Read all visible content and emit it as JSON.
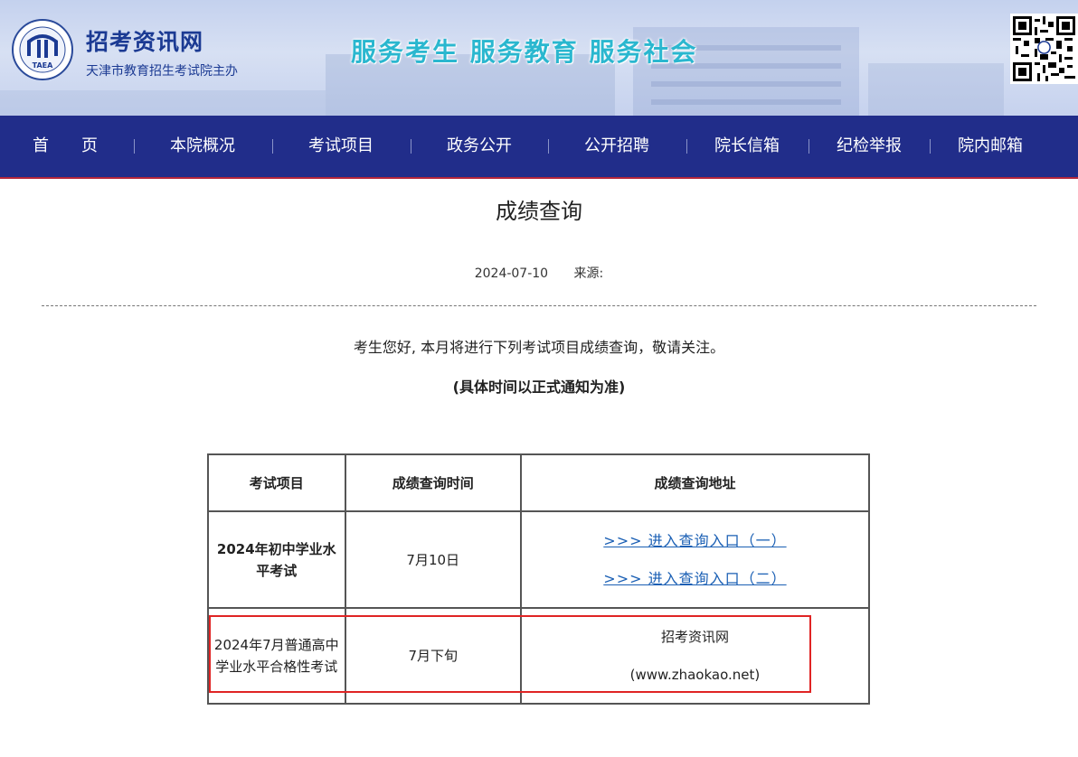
{
  "header": {
    "logo_label": "TAEA",
    "site_title": "招考资讯网",
    "site_subtitle": "天津市教育招生考试院主办",
    "slogan": "服务考生  服务教育  服务社会"
  },
  "nav": {
    "items": [
      "首　　页",
      "本院概况",
      "考试项目",
      "政务公开",
      "公开招聘",
      "院长信箱",
      "纪检举报",
      "院内邮箱"
    ]
  },
  "article": {
    "title": "成绩查询",
    "date": "2024-07-10",
    "source_label": "来源:",
    "intro": "考生您好, 本月将进行下列考试项目成绩查询，敬请关注。",
    "note": "(具体时间以正式通知为准)"
  },
  "table": {
    "headers": [
      "考试项目",
      "成绩查询时间",
      "成绩查询地址"
    ],
    "rows": [
      {
        "exam_line1": "2024年初中学业水",
        "exam_line2": "平考试",
        "time": "7月10日",
        "link1": ">>> 进入查询入口（一）",
        "link2": ">>> 进入查询入口（二）"
      },
      {
        "exam_line1": "2024年7月普通高中",
        "exam_line2": "学业水平合格性考试",
        "time": "7月下旬",
        "addr_line1": "招考资讯网",
        "addr_line2": "(www.zhaokao.net)"
      }
    ]
  },
  "colors": {
    "nav_bg": "#212d8a",
    "title_blue": "#1b3a93",
    "slogan": "#2ab7cf",
    "link": "#1a5fb4",
    "highlight": "#e02424"
  }
}
